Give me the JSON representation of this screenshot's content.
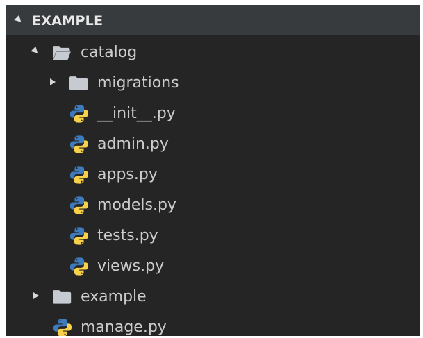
{
  "explorer": {
    "section_title": "EXAMPLE",
    "tree": [
      {
        "label": "catalog",
        "kind": "folder",
        "expanded": true,
        "icon": "folder-open-icon"
      },
      {
        "label": "migrations",
        "kind": "folder",
        "expanded": false,
        "icon": "folder-icon"
      },
      {
        "label": "__init__.py",
        "kind": "file",
        "icon": "python-icon"
      },
      {
        "label": "admin.py",
        "kind": "file",
        "icon": "python-icon"
      },
      {
        "label": "apps.py",
        "kind": "file",
        "icon": "python-icon"
      },
      {
        "label": "models.py",
        "kind": "file",
        "icon": "python-icon"
      },
      {
        "label": "tests.py",
        "kind": "file",
        "icon": "python-icon"
      },
      {
        "label": "views.py",
        "kind": "file",
        "icon": "python-icon"
      },
      {
        "label": "example",
        "kind": "folder",
        "expanded": false,
        "icon": "folder-icon"
      },
      {
        "label": "manage.py",
        "kind": "file",
        "icon": "python-icon"
      }
    ]
  },
  "colors": {
    "panel_background": "#252526",
    "header_background": "#383b3d",
    "text": "#cccccc",
    "folder_icon": "#c5cbd0",
    "python_blue": "#3e7bbd",
    "python_yellow": "#f7d14a"
  }
}
